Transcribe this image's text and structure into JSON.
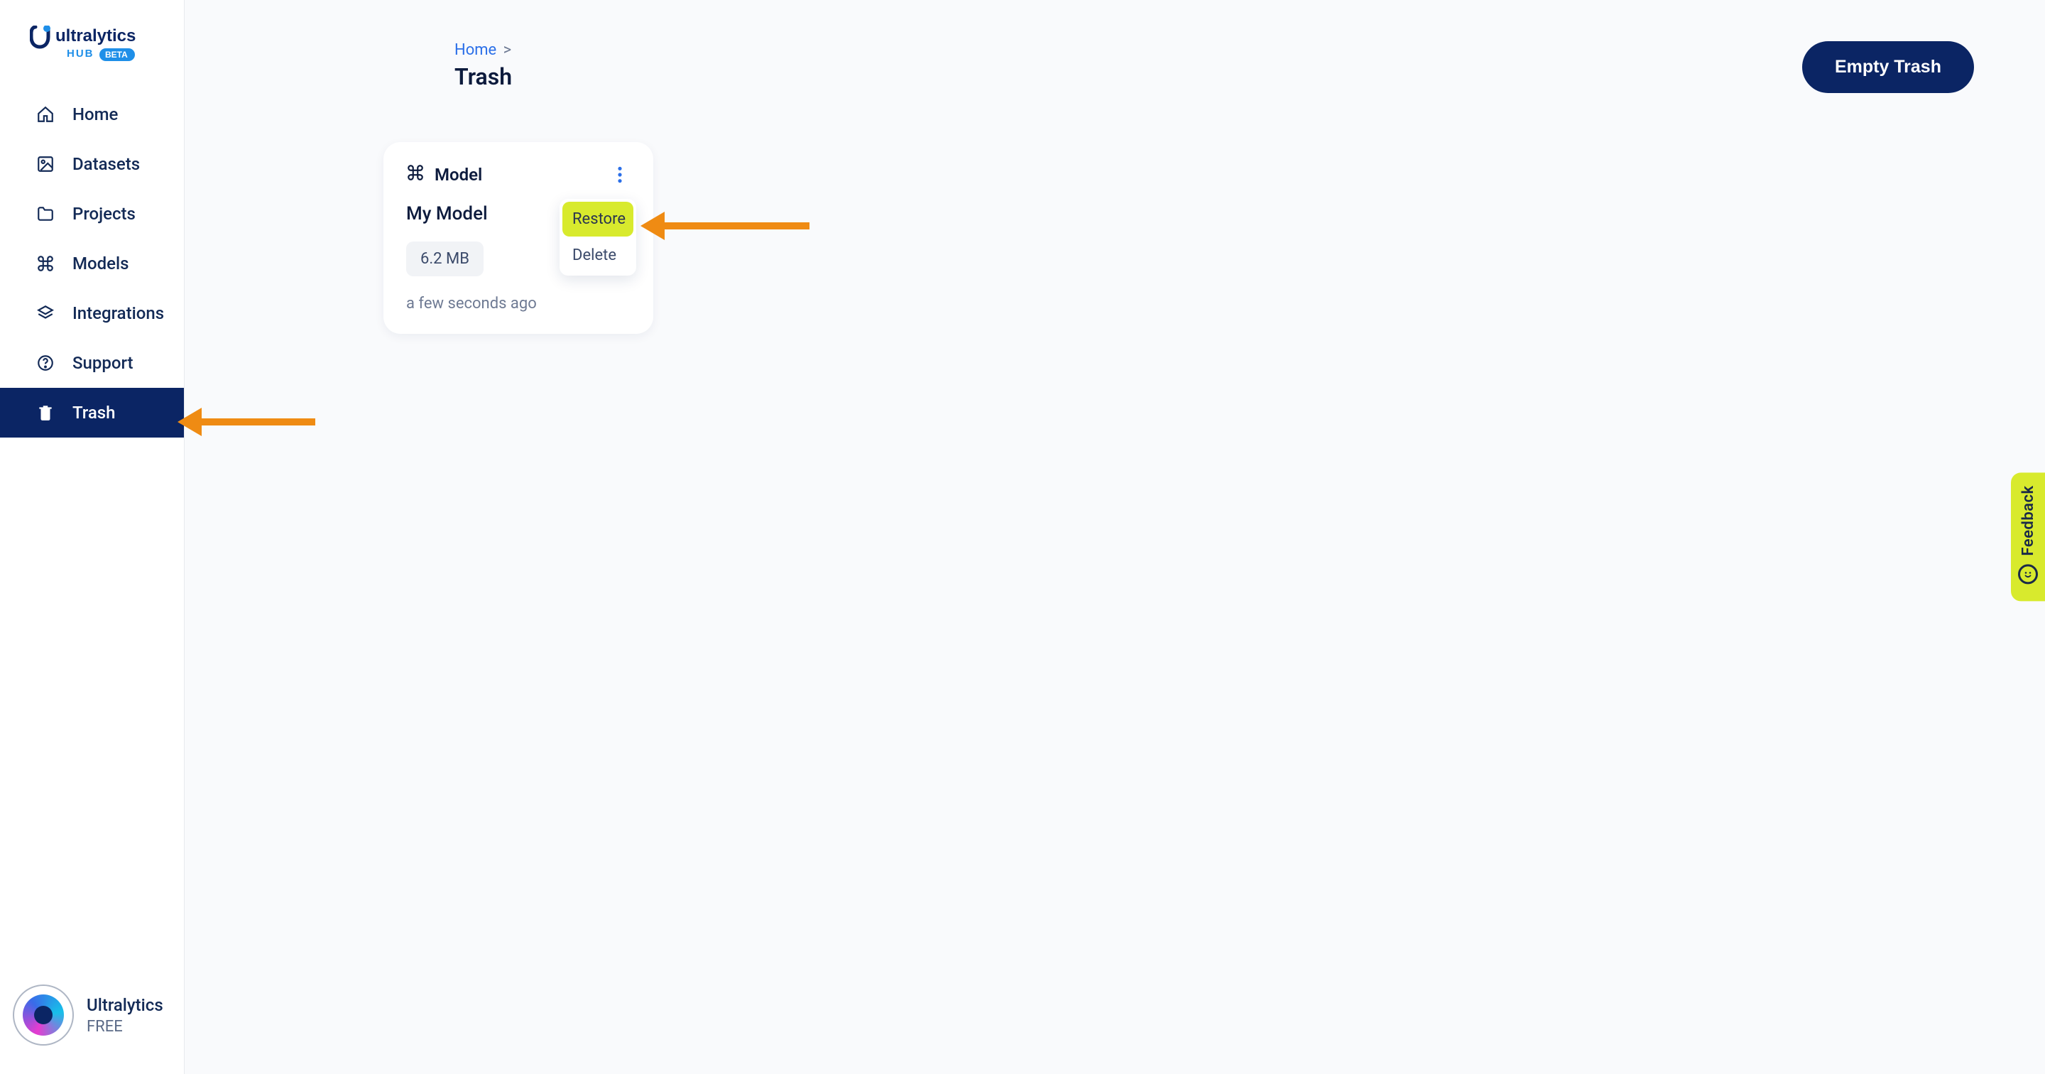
{
  "brand": {
    "name": "ultralytics",
    "sub": "HUB",
    "badge": "BETA"
  },
  "sidebar": {
    "items": [
      {
        "label": "Home",
        "active": false
      },
      {
        "label": "Datasets",
        "active": false
      },
      {
        "label": "Projects",
        "active": false
      },
      {
        "label": "Models",
        "active": false
      },
      {
        "label": "Integrations",
        "active": false
      },
      {
        "label": "Support",
        "active": false
      },
      {
        "label": "Trash",
        "active": true
      }
    ]
  },
  "user": {
    "name": "Ultralytics",
    "plan": "FREE"
  },
  "breadcrumb": {
    "root": "Home",
    "sep": ">"
  },
  "page": {
    "title": "Trash",
    "empty_button": "Empty Trash"
  },
  "card": {
    "type_label": "Model",
    "title": "My Model",
    "size": "6.2 MB",
    "time": "a few seconds ago"
  },
  "dropdown": {
    "restore": "Restore",
    "delete": "Delete"
  },
  "feedback": {
    "label": "Feedback"
  }
}
